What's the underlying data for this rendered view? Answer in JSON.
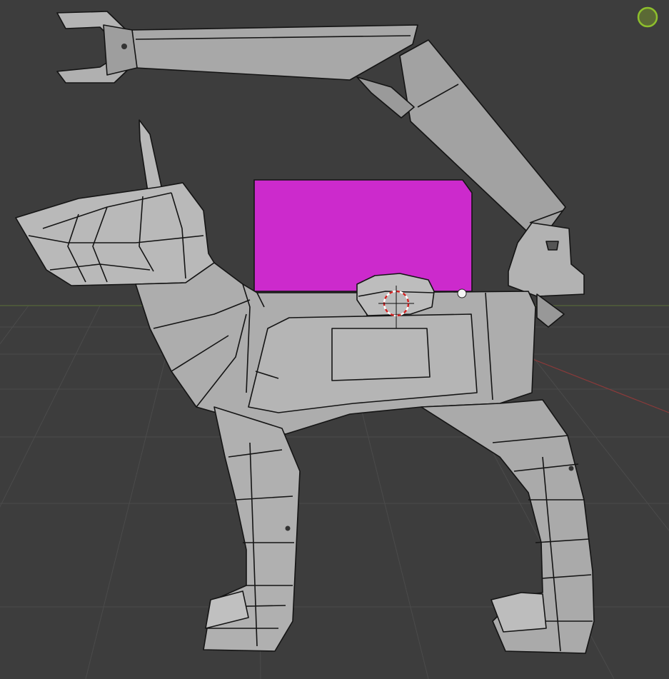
{
  "viewport": {
    "background_color": "#3d3d3d",
    "grid_color": "#4b4b4b",
    "x_axis_color": "#8a3a3a",
    "y_axis_color": "#58693a"
  },
  "model": {
    "body_color": "#a6a6a6",
    "light_face_color": "#c4c4c4",
    "dark_face_color": "#868686",
    "wire_color": "#141414",
    "selected_face_color": "#cc2acc"
  },
  "overlay": {
    "navigation_gizmo_icon": "camera-orbit-circle-icon",
    "navigation_gizmo_color": "#8dbf2c",
    "cursor_icon": "3d-cursor-icon",
    "cursor_colors": [
      "#ffffff",
      "#d01f1f"
    ],
    "light_icon": "light-dot-icon"
  }
}
